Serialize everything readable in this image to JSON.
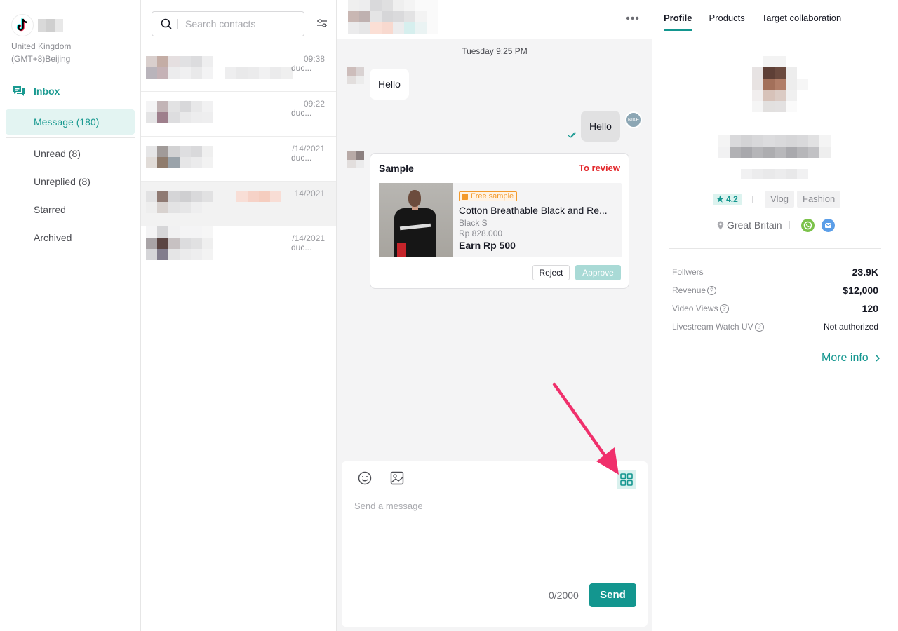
{
  "sidebar": {
    "region_line1": "United Kingdom",
    "region_line2": "(GMT+8)Beijing",
    "inbox_label": "Inbox",
    "items": [
      {
        "label": "Message (180)"
      },
      {
        "label": "Unread (8)"
      },
      {
        "label": "Unreplied  (8)"
      },
      {
        "label": "Starred"
      },
      {
        "label": "Archived"
      }
    ]
  },
  "contacts": {
    "search_placeholder": "Search contacts",
    "list": [
      {
        "time": "09:38",
        "snippet": "duc..."
      },
      {
        "time": "09:22",
        "snippet": "duc..."
      },
      {
        "time": "/14/2021",
        "snippet": "duc..."
      },
      {
        "time": "14/2021",
        "snippet": ""
      },
      {
        "time": "/14/2021",
        "snippet": "duc..."
      }
    ]
  },
  "chat": {
    "date": "Tuesday  9:25 PM",
    "incoming_message": "Hello",
    "outgoing_message": "Hello",
    "card": {
      "title": "Sample",
      "status": "To review",
      "badge": "Free sample",
      "product_name": "Cotton Breathable Black and Re...",
      "variant": "Black  S",
      "price": "Rp 828.000",
      "earn": "Earn Rp 500",
      "reject_label": "Reject",
      "approve_label": "Approve"
    },
    "composer": {
      "placeholder": "Send a message",
      "counter": "0/2000",
      "send_label": "Send"
    }
  },
  "profile": {
    "tabs": [
      "Profile",
      "Products",
      "Target collaboration"
    ],
    "rating": "4.2",
    "tags": [
      "Vlog",
      "Fashion"
    ],
    "location": "Great Britain",
    "stats": [
      {
        "label": "Follwers",
        "value": "23.9K",
        "help": false
      },
      {
        "label": "Revenue",
        "value": "$12,000",
        "help": true
      },
      {
        "label": "Video Views",
        "value": "120",
        "help": true
      },
      {
        "label": "Livestream Watch UV",
        "value": "Not authorized",
        "help": true
      }
    ],
    "more_info": "More info"
  }
}
